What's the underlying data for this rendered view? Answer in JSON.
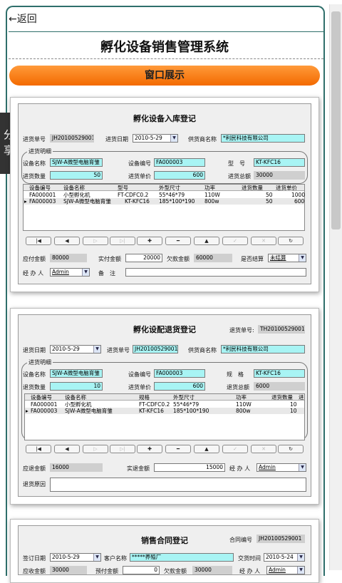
{
  "top": {
    "back": "←返回",
    "title": "孵化设备销售管理系统",
    "banner": "窗口展示",
    "share": "分享"
  },
  "p1": {
    "title": "孵化设备入库登记",
    "l_no": "进货单号",
    "no": "JH20100529001",
    "l_date": "进货日期",
    "date": "2010-5-29",
    "l_sup": "供货商名称",
    "sup": "*利民科技有限公司",
    "grp": "进货明细",
    "l_dev": "设备名称",
    "dev": "SJW-A微型电脑育雏",
    "l_code": "设备编号",
    "code": "FA000003",
    "l_model": "型　号",
    "model": "KT-KFC16",
    "l_qty": "进货数量",
    "qty": "50",
    "l_price": "进货单价",
    "price": "600",
    "l_total": "进货总额",
    "total": "30000",
    "cols": [
      "设备编号",
      "设备名称",
      "型号",
      "外型尺寸",
      "功率",
      "进货数量",
      "进货单价"
    ],
    "rows": [
      [
        "FA000001",
        "小型孵化机",
        "FT-CDFC0.2",
        "55*46*79",
        "110W",
        "50",
        "1000"
      ],
      [
        "FA000003",
        "SJW-A微型电脑育雏",
        "KT-KFC16",
        "185*100*190",
        "800w",
        "50",
        "600"
      ]
    ],
    "l_due": "应付金额",
    "due": "80000",
    "l_paid": "实付金额",
    "paid": "20000",
    "l_owe": "欠款金额",
    "owe": "60000",
    "l_settle": "是否结算",
    "settle": "未结算",
    "l_op": "经 办 人",
    "op": "Admin",
    "l_note": "备　注"
  },
  "p2": {
    "title": "孵化设配退货登记",
    "l_no": "退货单号:",
    "no": "TH20100529001",
    "l_date": "退货日期",
    "date": "2010-5-29",
    "l_in": "进货单号",
    "in": "JH20100529001",
    "l_sup": "供货商名称",
    "sup": "*利民科技有限公司",
    "grp": "进货明细",
    "l_dev": "设备名称",
    "dev": "SJW-A微型电脑育雏",
    "l_code": "设备编号",
    "code": "FA000003",
    "l_spec": "规　格",
    "spec": "KT-KFC16",
    "l_qty": "退货数量",
    "qty": "10",
    "l_price": "进货单价",
    "price": "600",
    "l_total": "退货总额",
    "total": "6000",
    "cols": [
      "设备编号",
      "设备名称",
      "规格",
      "外型尺寸",
      "功率",
      "退货数量",
      "进"
    ],
    "rows": [
      [
        "FA000001",
        "小型孵化机",
        "FT-CDFC0.2",
        "55*46*79",
        "110W",
        "10"
      ],
      [
        "FA000003",
        "SJW-A微型电脑育雏",
        "KT-KFC16",
        "185*100*190",
        "800w",
        "10"
      ]
    ],
    "l_refund": "应退金额",
    "refund": "16000",
    "l_real": "实退金额",
    "real": "15000",
    "l_op": "经 办 人",
    "op": "Admin",
    "l_reason": "退货原因"
  },
  "p3": {
    "title": "销售合同登记",
    "l_no": "合同编号",
    "no": "JH20100529001",
    "l_sign": "签订日期",
    "sign": "2010-5-29",
    "l_cust": "客户名称",
    "cust": "*****养殖厂",
    "l_deliv": "交货时间",
    "deliv": "2010-5-24",
    "l_due": "应收金额",
    "due": "30000",
    "l_pre": "预付金额",
    "pre": "0",
    "l_owe": "欠款金额",
    "owe": "30000",
    "l_op": "经 办 人",
    "op": "Admin"
  },
  "nav": {
    "first": "|◀",
    "prev": "◀",
    "next": "▷",
    "last": "▷|",
    "add": "✚",
    "del": "━",
    "up": "▲",
    "ok": "✓",
    "cancel": "✕",
    "refresh": "↻"
  }
}
